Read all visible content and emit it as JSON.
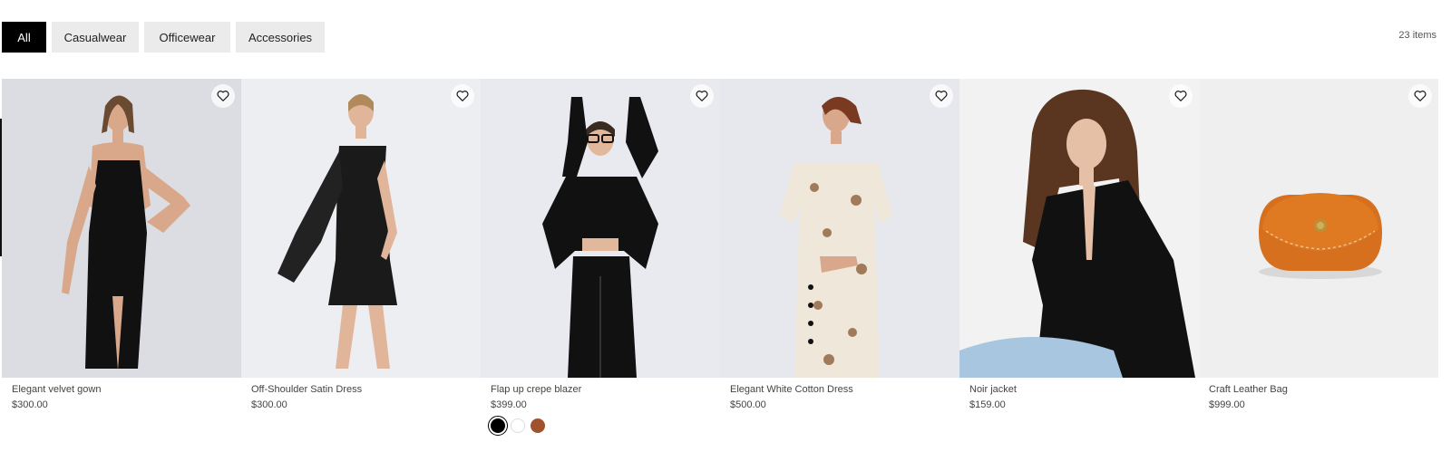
{
  "filters": {
    "items": [
      {
        "label": "All",
        "active": true
      },
      {
        "label": "Casualwear",
        "active": false
      },
      {
        "label": "Officewear",
        "active": false
      },
      {
        "label": "Accessories",
        "active": false
      }
    ],
    "count_label": "23 items"
  },
  "products": [
    {
      "title": "Elegant velvet gown",
      "price": "$300.00",
      "image": "woman-black-slip-dress",
      "wishlist_icon": "heart-outline-icon"
    },
    {
      "title": "Off-Shoulder Satin Dress",
      "price": "$300.00",
      "image": "woman-black-off-shoulder-dress",
      "wishlist_icon": "heart-outline-icon"
    },
    {
      "title": "Flap up crepe blazer",
      "price": "$399.00",
      "image": "woman-black-blazer-glasses",
      "wishlist_icon": "heart-outline-icon",
      "swatches": [
        "#000000",
        "#ffffff",
        "#a0522d"
      ],
      "selected_swatch": "#000000"
    },
    {
      "title": "Elegant White Cotton Dress",
      "price": "$500.00",
      "image": "woman-floral-white-dress",
      "wishlist_icon": "heart-outline-icon"
    },
    {
      "title": "Noir jacket",
      "price": "$159.00",
      "image": "woman-black-jacket-jeans",
      "wishlist_icon": "heart-outline-icon"
    },
    {
      "title": "Craft Leather Bag",
      "price": "$999.00",
      "image": "orange-leather-pouch",
      "wishlist_icon": "heart-outline-icon"
    }
  ]
}
